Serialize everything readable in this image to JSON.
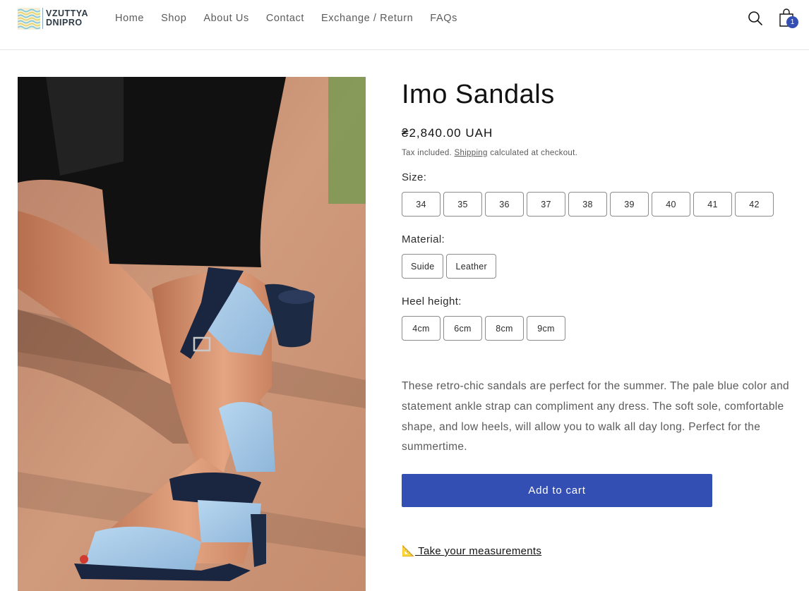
{
  "brand": {
    "line1": "VZUTTYA",
    "line2": "DNIPRO"
  },
  "nav": {
    "items": [
      {
        "label": "Home"
      },
      {
        "label": "Shop"
      },
      {
        "label": "About Us"
      },
      {
        "label": "Contact"
      },
      {
        "label": "Exchange / Return"
      },
      {
        "label": "FAQs"
      }
    ]
  },
  "header": {
    "search_icon": "search-icon",
    "cart_icon": "bag-icon",
    "cart_count": "1",
    "accent": "#334fb4"
  },
  "product": {
    "title": "Imo Sandals",
    "price": "₴2,840.00 UAH",
    "tax_prefix": "Tax included. ",
    "tax_link": "Shipping",
    "tax_suffix": " calculated at checkout.",
    "image_icon": "product-photo",
    "size": {
      "label": "Size:",
      "options": [
        "34",
        "35",
        "36",
        "37",
        "38",
        "39",
        "40",
        "41",
        "42"
      ]
    },
    "material": {
      "label": "Material:",
      "options": [
        "Suide",
        "Leather"
      ]
    },
    "heel": {
      "label": "Heel height:",
      "options": [
        "4cm",
        "6cm",
        "8cm",
        "9cm"
      ]
    },
    "description": "These retro-chic sandals are perfect for the summer. The pale blue color and statement ankle strap can compliment any dress. The soft sole, comfortable shape, and low heels, will allow you to walk all day long. Perfect for the summertime.",
    "add_to_cart": "Add to cart",
    "measure_emoji": "📐",
    "measure_label": " Take your measurements"
  }
}
